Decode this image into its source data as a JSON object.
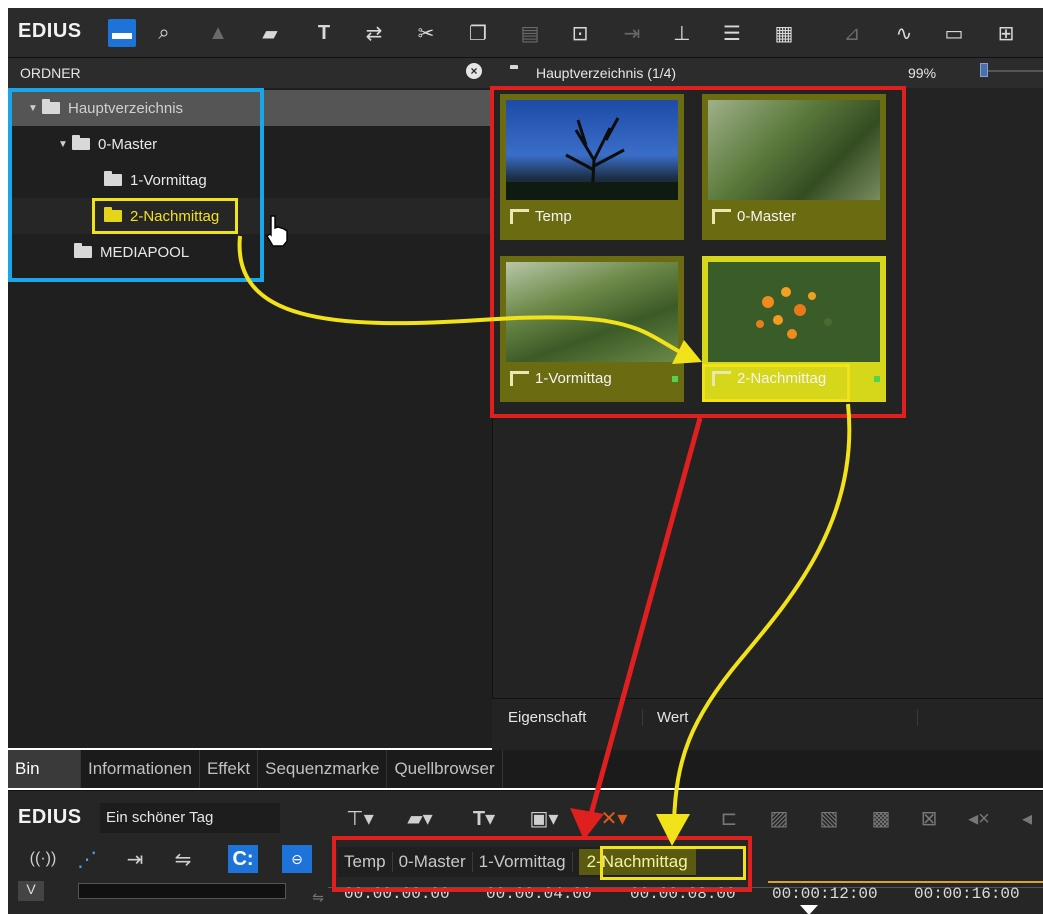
{
  "app": {
    "brand": "EDIUS"
  },
  "toolbar": {
    "icons": [
      "folder-icon",
      "search-icon",
      "up-icon",
      "open-folder-icon",
      "title-icon",
      "replace-icon",
      "cut-icon",
      "copy-icon",
      "paste-icon",
      "add-to-timeline-icon",
      "insert-icon",
      "overwrite-icon",
      "list-view-icon",
      "thumbnail-view-icon",
      "properties-icon",
      "waveform-icon",
      "window-icon",
      "toolbox-icon"
    ]
  },
  "folder_panel": {
    "title": "ORDNER",
    "tree": [
      {
        "label": "Hauptverzeichnis",
        "level": 0,
        "expanded": true,
        "selected": true
      },
      {
        "label": "0-Master",
        "level": 1,
        "expanded": true
      },
      {
        "label": "1-Vormittag",
        "level": 2
      },
      {
        "label": "2-Nachmittag",
        "level": 2,
        "highlighted": true
      },
      {
        "label": "MEDIAPOOL",
        "level": 1
      }
    ]
  },
  "bin": {
    "title": "Hauptverzeichnis (1/4)",
    "zoom": "99%",
    "items": [
      {
        "label": "Temp"
      },
      {
        "label": "0-Master"
      },
      {
        "label": "1-Vormittag"
      },
      {
        "label": "2-Nachmittag",
        "selected": true
      }
    ]
  },
  "properties": {
    "col_property": "Eigenschaft",
    "col_value": "Wert"
  },
  "tabs": [
    "Bin",
    "Informationen",
    "Effekt",
    "Sequenzmarke",
    "Quellbrowser"
  ],
  "timeline": {
    "project_name": "Ein schöner Tag",
    "sequence_tabs": [
      "Temp",
      "0-Master",
      "1-Vormittag",
      "2-Nachmittag"
    ],
    "track_label": "V",
    "ruler": [
      "00:00:00:00",
      "00:00:04:00",
      "00:00:08:00",
      "00:00:12:00",
      "00:00:16:00"
    ]
  },
  "colors": {
    "accent_blue": "#1e73d8",
    "annotation_blue": "#1aa6ea",
    "annotation_red": "#e01f1f",
    "annotation_yellow": "#f2e21a",
    "clip_olive": "#6b6b11"
  }
}
